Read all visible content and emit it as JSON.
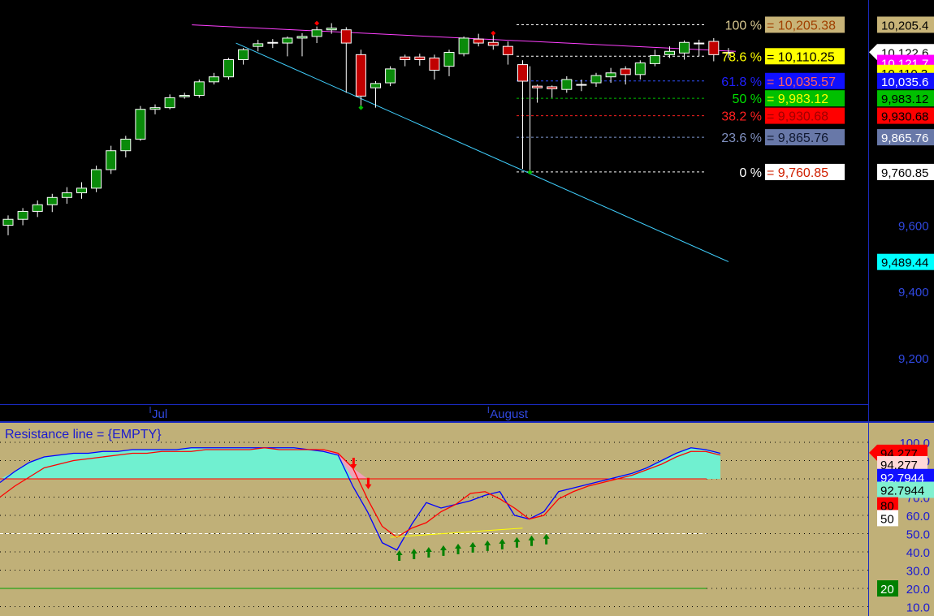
{
  "chart_data": [
    {
      "type": "candlestick",
      "pane": "price",
      "x_labels": [
        {
          "index": 10,
          "text": "Jul"
        },
        {
          "index": 33,
          "text": "August"
        }
      ],
      "ylim": [
        9060,
        10280
      ],
      "y_ticks": [
        "9,200",
        "9,400",
        "9,600"
      ],
      "candles": [
        {
          "o": 9600,
          "h": 9630,
          "l": 9570,
          "c": 9618
        },
        {
          "o": 9618,
          "h": 9652,
          "l": 9600,
          "c": 9642
        },
        {
          "o": 9642,
          "h": 9675,
          "l": 9625,
          "c": 9662
        },
        {
          "o": 9662,
          "h": 9695,
          "l": 9640,
          "c": 9684
        },
        {
          "o": 9684,
          "h": 9715,
          "l": 9665,
          "c": 9698
        },
        {
          "o": 9698,
          "h": 9730,
          "l": 9680,
          "c": 9712
        },
        {
          "o": 9712,
          "h": 9780,
          "l": 9700,
          "c": 9768
        },
        {
          "o": 9768,
          "h": 9840,
          "l": 9755,
          "c": 9825
        },
        {
          "o": 9825,
          "h": 9870,
          "l": 9805,
          "c": 9860
        },
        {
          "o": 9860,
          "h": 9960,
          "l": 9855,
          "c": 9950
        },
        {
          "o": 9950,
          "h": 9965,
          "l": 9935,
          "c": 9955
        },
        {
          "o": 9955,
          "h": 9995,
          "l": 9950,
          "c": 9985
        },
        {
          "o": 9988,
          "h": 10000,
          "l": 9982,
          "c": 9992
        },
        {
          "o": 9992,
          "h": 10040,
          "l": 9985,
          "c": 10033
        },
        {
          "o": 10033,
          "h": 10060,
          "l": 10025,
          "c": 10048
        },
        {
          "o": 10048,
          "h": 10105,
          "l": 10040,
          "c": 10100
        },
        {
          "o": 10100,
          "h": 10135,
          "l": 10085,
          "c": 10130
        },
        {
          "o": 10140,
          "h": 10160,
          "l": 10125,
          "c": 10148
        },
        {
          "o": 10152,
          "h": 10162,
          "l": 10135,
          "c": 10150
        },
        {
          "o": 10150,
          "h": 10170,
          "l": 10110,
          "c": 10165
        },
        {
          "o": 10165,
          "h": 10180,
          "l": 10110,
          "c": 10170
        },
        {
          "o": 10170,
          "h": 10200,
          "l": 10150,
          "c": 10190
        },
        {
          "o": 10190,
          "h": 10210,
          "l": 10178,
          "c": 10195
        },
        {
          "o": 10190,
          "h": 10198,
          "l": 10000,
          "c": 10150
        },
        {
          "o": 10115,
          "h": 10130,
          "l": 9960,
          "c": 9990
        },
        {
          "o": 10015,
          "h": 10035,
          "l": 9955,
          "c": 10028
        },
        {
          "o": 10030,
          "h": 10080,
          "l": 10020,
          "c": 10072
        },
        {
          "o": 10108,
          "h": 10115,
          "l": 10080,
          "c": 10100
        },
        {
          "o": 10108,
          "h": 10118,
          "l": 10082,
          "c": 10100
        },
        {
          "o": 10105,
          "h": 10115,
          "l": 10040,
          "c": 10068
        },
        {
          "o": 10080,
          "h": 10130,
          "l": 10050,
          "c": 10122
        },
        {
          "o": 10118,
          "h": 10170,
          "l": 10110,
          "c": 10165
        },
        {
          "o": 10162,
          "h": 10178,
          "l": 10140,
          "c": 10150
        },
        {
          "o": 10152,
          "h": 10175,
          "l": 10130,
          "c": 10143
        },
        {
          "o": 10140,
          "h": 10155,
          "l": 10085,
          "c": 10115
        },
        {
          "o": 10085,
          "h": 10098,
          "l": 9770,
          "c": 10035
        },
        {
          "o": 10020,
          "h": 10025,
          "l": 9970,
          "c": 10015
        },
        {
          "o": 10018,
          "h": 10022,
          "l": 9985,
          "c": 10012
        },
        {
          "o": 10010,
          "h": 10050,
          "l": 10000,
          "c": 10040
        },
        {
          "o": 10025,
          "h": 10040,
          "l": 10005,
          "c": 10025
        },
        {
          "o": 10030,
          "h": 10060,
          "l": 10018,
          "c": 10052
        },
        {
          "o": 10048,
          "h": 10075,
          "l": 10030,
          "c": 10060
        },
        {
          "o": 10072,
          "h": 10080,
          "l": 10025,
          "c": 10055
        },
        {
          "o": 10055,
          "h": 10098,
          "l": 10040,
          "c": 10090
        },
        {
          "o": 10088,
          "h": 10130,
          "l": 10080,
          "c": 10112
        },
        {
          "o": 10115,
          "h": 10140,
          "l": 10105,
          "c": 10125
        },
        {
          "o": 10120,
          "h": 10158,
          "l": 10100,
          "c": 10152
        },
        {
          "o": 10148,
          "h": 10160,
          "l": 10110,
          "c": 10150
        },
        {
          "o": 10155,
          "h": 10165,
          "l": 10095,
          "c": 10115
        },
        {
          "o": 10120,
          "h": 10135,
          "l": 10105,
          "c": 10122
        }
      ],
      "fib_levels": [
        {
          "pct": "100 %",
          "value": "= 10,205.38",
          "y": 10205.38,
          "pct_color": "#d8c890",
          "box_bg": "#c8b478",
          "box_fg": "#a04000",
          "line_color": "#ffffff"
        },
        {
          "pct": "78.6 %",
          "value": "= 10,110.25",
          "y": 10110.25,
          "pct_color": "#ffff00",
          "box_bg": "#ffff00",
          "box_fg": "#000000",
          "line_color": "#ffffff"
        },
        {
          "pct": "61.8 %",
          "value": "= 10,035.57",
          "y": 10035.57,
          "pct_color": "#2020ff",
          "box_bg": "#1010ff",
          "box_fg": "#ff6060",
          "line_color": "#3050ff"
        },
        {
          "pct": "50  %",
          "value": "= 9,983.12",
          "y": 9983.12,
          "pct_color": "#00e000",
          "box_bg": "#00c000",
          "box_fg": "#ffff00",
          "line_color": "#00c000"
        },
        {
          "pct": "38.2 %",
          "value": "= 9,930.68",
          "y": 9930.68,
          "pct_color": "#ff2020",
          "box_bg": "#ff0000",
          "box_fg": "#a00000",
          "line_color": "#ff2020"
        },
        {
          "pct": "23.6 %",
          "value": "= 9,865.76",
          "y": 9865.76,
          "pct_color": "#8090c0",
          "box_bg": "#6878a8",
          "box_fg": "#101830",
          "line_color": "#8098d0"
        },
        {
          "pct": "0 %",
          "value": "= 9,760.85",
          "y": 9760.85,
          "pct_color": "#ffffff",
          "box_bg": "#ffffff",
          "box_fg": "#d02000",
          "line_color": "#ffffff"
        }
      ],
      "price_tags": [
        {
          "text": "10,205.4",
          "y": 10205.4,
          "bg": "#c8b478",
          "fg": "#000000"
        },
        {
          "text": "10,122.6",
          "y": 10122.6,
          "bg": "#ffffff",
          "fg": "#000000",
          "pointer": true
        },
        {
          "text": "10,121.7",
          "y": 10090,
          "bg": "#ff00ff",
          "fg": "#ffffff"
        },
        {
          "text": "10,110.3",
          "y": 10060,
          "bg": "#ffff00",
          "fg": "#000000"
        },
        {
          "text": "10,035.6",
          "y": 10035.6,
          "bg": "#1010ff",
          "fg": "#ffffff"
        },
        {
          "text": "9,983.12",
          "y": 9983.12,
          "bg": "#00c000",
          "fg": "#000000"
        },
        {
          "text": "9,930.68",
          "y": 9930.68,
          "bg": "#ff0000",
          "fg": "#000000"
        },
        {
          "text": "9,865.76",
          "y": 9865.76,
          "bg": "#6878a8",
          "fg": "#ffffff"
        },
        {
          "text": "9,760.85",
          "y": 9760.85,
          "bg": "#ffffff",
          "fg": "#000000"
        },
        {
          "text": "9,489.44",
          "y": 9489.44,
          "bg": "#00ffff",
          "fg": "#000000"
        }
      ],
      "trendlines": [
        {
          "color": "#ff40ff",
          "x1": 12.5,
          "y1": 10205,
          "x2": 49.5,
          "y2": 10125
        },
        {
          "color": "#40d0ff",
          "x1": 15.5,
          "y1": 10150,
          "x2": 49,
          "y2": 9490
        }
      ],
      "markers": [
        {
          "index": 21,
          "y": 10210,
          "color": "#ff0000"
        },
        {
          "index": 33,
          "y": 10180,
          "color": "#ff0000"
        },
        {
          "index": 24,
          "y": 9955,
          "color": "#00c000"
        },
        {
          "index": 35.5,
          "y": 9760,
          "color": "#00c000"
        }
      ],
      "swing_line": {
        "index": 35.5,
        "from": 10080,
        "to": 9765,
        "color": "#ffffff"
      },
      "colors": {
        "up": "#0a8a0a",
        "down": "#c00000",
        "background": "#000000"
      }
    },
    {
      "type": "line",
      "pane": "oscillator",
      "title": "Resistance line = {EMPTY}",
      "ylim": [
        5,
        105
      ],
      "y_ticks": [
        "10.0",
        "20.0",
        "30.0",
        "40.0",
        "50.0",
        "60.0",
        "70.0",
        "80.0",
        "90.0",
        "100.0"
      ],
      "series": [
        {
          "color": "#0000ff",
          "values": [
            78,
            84,
            89,
            92,
            93,
            94,
            94,
            95,
            95,
            96,
            96,
            96,
            96,
            97,
            97,
            97,
            97,
            97,
            97,
            97,
            97,
            96,
            95,
            93,
            76,
            62,
            45,
            41,
            55,
            67,
            64,
            66,
            68,
            71,
            73,
            60,
            58,
            62,
            73,
            75,
            77,
            79,
            81,
            83,
            86,
            90,
            94,
            97,
            96,
            94
          ]
        },
        {
          "color": "#ff0000",
          "values": [
            70,
            76,
            81,
            86,
            88,
            90,
            91,
            92,
            93,
            94,
            94,
            95,
            95,
            95,
            96,
            96,
            96,
            96,
            97,
            96,
            96,
            96,
            96,
            94,
            86,
            69,
            54,
            48,
            53,
            56,
            62,
            66,
            72,
            73,
            69,
            64,
            58,
            60,
            69,
            73,
            76,
            78,
            80,
            82,
            85,
            88,
            92,
            95,
            95,
            93
          ]
        }
      ],
      "fill_color": "#70f0d0",
      "h_lines": [
        {
          "y": 80,
          "color": "#ff0000",
          "style": "solid"
        },
        {
          "y": 50,
          "color": "#ffffff",
          "style": "dashed"
        },
        {
          "y": 20,
          "color": "#00a000",
          "style": "solid"
        }
      ],
      "support_line": {
        "x1": 26,
        "y1": 48,
        "x2": 35,
        "y2": 53,
        "color": "#ffff00"
      },
      "down_arrows": [
        {
          "index": 23.5,
          "y": 88
        },
        {
          "index": 24.5,
          "y": 77
        }
      ],
      "up_arrows": [
        26.5,
        27.5,
        28.5,
        29.5,
        30.5,
        31.5,
        32.5,
        33.5,
        34.5,
        35.5,
        36.5
      ],
      "value_tags": [
        {
          "text": "94.277",
          "y": 94.277,
          "bg": "#ff0000",
          "fg": "#000000",
          "pointer": true
        },
        {
          "text": "94.277",
          "y": 88,
          "bg": "#ffd8d8",
          "fg": "#000000"
        },
        {
          "text": "92.7944",
          "y": 81,
          "bg": "#1010ff",
          "fg": "#ffffff"
        },
        {
          "text": "92.7944",
          "y": 74,
          "bg": "#80f0d0",
          "fg": "#000000"
        },
        {
          "text": "80",
          "y": 65.5,
          "bg": "#ff0000",
          "fg": "#000000"
        },
        {
          "text": "50",
          "y": 58.5,
          "bg": "#ffffff",
          "fg": "#000000"
        },
        {
          "text": "20",
          "y": 20,
          "bg": "#008000",
          "fg": "#ffffff"
        }
      ],
      "background": "#c0b078"
    }
  ]
}
